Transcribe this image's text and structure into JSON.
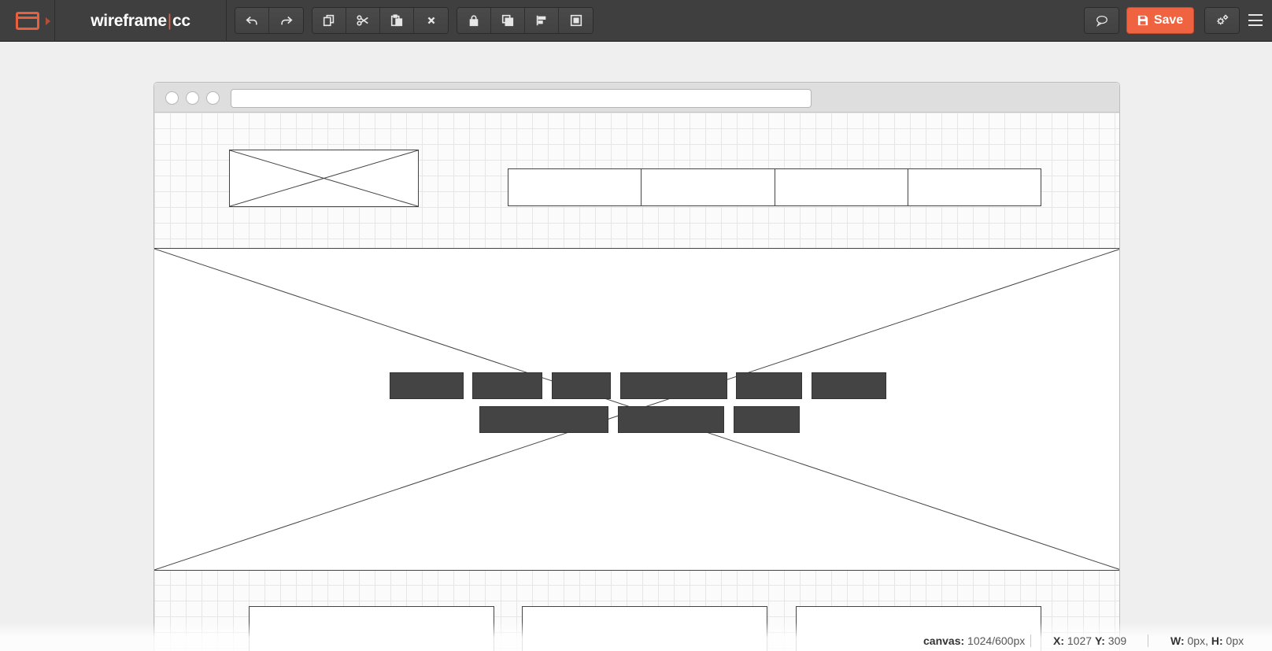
{
  "app": {
    "brand_left": "wireframe",
    "brand_sep": "|",
    "brand_right": "cc",
    "accent_color": "#ef6341"
  },
  "toolbar": {
    "history": [
      {
        "name": "undo-button",
        "icon": "undo-icon"
      },
      {
        "name": "redo-button",
        "icon": "redo-icon"
      }
    ],
    "edit": [
      {
        "name": "duplicate-button",
        "icon": "duplicate-icon"
      },
      {
        "name": "cut-button",
        "icon": "scissors-icon"
      },
      {
        "name": "paste-button",
        "icon": "paste-icon"
      },
      {
        "name": "delete-button",
        "icon": "close-icon"
      }
    ],
    "arrange": [
      {
        "name": "lock-button",
        "icon": "lock-icon"
      },
      {
        "name": "bring-front-button",
        "icon": "layers-icon"
      },
      {
        "name": "align-left-button",
        "icon": "align-left-icon"
      },
      {
        "name": "group-button",
        "icon": "group-icon"
      }
    ],
    "comment_icon": "speech-bubble-icon",
    "save_label": "Save",
    "save_icon": "floppy-disk-icon",
    "settings_icon": "gears-icon",
    "menu_icon": "hamburger-icon"
  },
  "canvas": {
    "nav_items": 4,
    "hero_tag_rows": 2,
    "bottom_boxes": 3
  },
  "status": {
    "canvas_label": "canvas:",
    "canvas_value": "1024/600px",
    "x_label": "X:",
    "x_value": "1027",
    "y_label": "Y:",
    "y_value": "309",
    "w_label": "W:",
    "w_value": "0px,",
    "h_label": "H:",
    "h_value": "0px"
  }
}
